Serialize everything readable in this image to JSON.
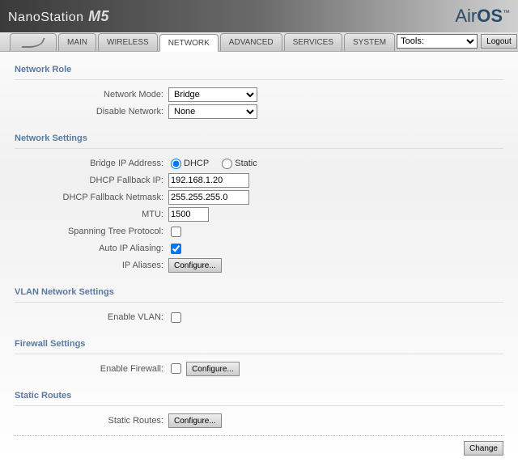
{
  "header": {
    "product_a": "NanoStation",
    "product_b": " M5",
    "brand_air": "Air",
    "brand_os": "OS",
    "brand_tm": "™"
  },
  "tabs": {
    "main": "MAIN",
    "wireless": "WIRELESS",
    "network": "NETWORK",
    "advanced": "ADVANCED",
    "services": "SERVICES",
    "system": "SYSTEM"
  },
  "toolbar": {
    "tools_label": "Tools:",
    "logout": "Logout"
  },
  "sections": {
    "network_role": "Network Role",
    "network_settings": "Network Settings",
    "vlan_settings": "VLAN Network Settings",
    "firewall_settings": "Firewall Settings",
    "static_routes": "Static Routes"
  },
  "labels": {
    "network_mode": "Network Mode:",
    "disable_network": "Disable Network:",
    "bridge_ip": "Bridge IP Address:",
    "dhcp_fallback_ip": "DHCP Fallback IP:",
    "dhcp_fallback_netmask": "DHCP Fallback Netmask:",
    "mtu": "MTU:",
    "stp": "Spanning Tree Protocol:",
    "auto_ip": "Auto IP Aliasing:",
    "ip_aliases": "IP Aliases:",
    "enable_vlan": "Enable VLAN:",
    "enable_firewall": "Enable Firewall:",
    "static_routes": "Static Routes:"
  },
  "values": {
    "network_mode": "Bridge",
    "disable_network": "None",
    "bridge_ip_mode": "dhcp",
    "radio_dhcp": "DHCP",
    "radio_static": "Static",
    "dhcp_fallback_ip": "192.168.1.20",
    "dhcp_fallback_netmask": "255.255.255.0",
    "mtu": "1500",
    "stp_checked": false,
    "auto_ip_checked": true,
    "enable_vlan_checked": false,
    "enable_firewall_checked": false
  },
  "buttons": {
    "configure": "Configure...",
    "change": "Change"
  }
}
